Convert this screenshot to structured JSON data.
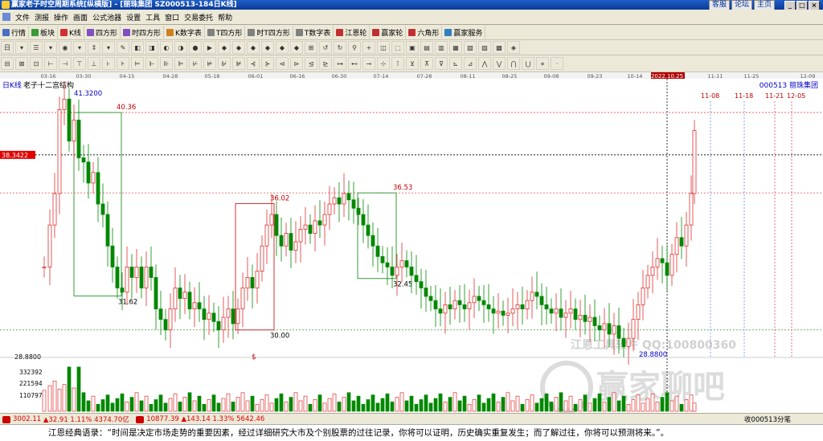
{
  "window": {
    "title": "赢家老子时空周期系统[纵横版] - [丽珠集团  SZ000513-184日K线]",
    "links": [
      "客服",
      "论坛",
      "主页"
    ],
    "controls": [
      "_",
      "□",
      "×"
    ]
  },
  "menu": [
    "文件",
    "测报",
    "操作",
    "画面",
    "公式池器",
    "设置",
    "工具",
    "窗口",
    "交易委托",
    "帮助"
  ],
  "toolbar1": [
    {
      "label": "行情",
      "color": "#4a6fc0"
    },
    {
      "label": "板块",
      "color": "#3a9a3a"
    },
    {
      "label": "K线",
      "color": "#d03030"
    },
    {
      "label": "四方形",
      "color": "#8050c0"
    },
    {
      "label": "时四方形",
      "color": "#8050c0"
    },
    {
      "label": "K数字表",
      "color": "#d08020"
    },
    {
      "label": "T四方形",
      "color": "#808080"
    },
    {
      "label": "时T四方形",
      "color": "#808080"
    },
    {
      "label": "T数字表",
      "color": "#808080"
    },
    {
      "label": "江恩轮",
      "color": "#c03030"
    },
    {
      "label": "赢家轮",
      "color": "#c03030"
    },
    {
      "label": "六角形",
      "color": "#c03030"
    },
    {
      "label": "赢家服务",
      "color": "#3080c0"
    }
  ],
  "toolbar2": [
    "日",
    "▾",
    "☰",
    "▾",
    "◉",
    "▾",
    "⇕",
    "▾",
    "✎",
    "◧",
    "◨",
    "◐",
    "◑",
    "●",
    "▶",
    "◆",
    "◆",
    "◆",
    "◆",
    "◆",
    "◆",
    "⊞",
    "↺",
    "↻",
    "⚲",
    "+",
    "◫",
    "⬚",
    "▣",
    "▤",
    "▥",
    "▦",
    "▧",
    "▨",
    "▩",
    "◈"
  ],
  "toolbar3": [
    "⊟",
    "⊠",
    "⊡",
    "⊢",
    "⊣",
    "⊤",
    "⊥",
    "⊦",
    "⊧",
    "⊨",
    "⊩",
    "⊪",
    "⊫",
    "⊬",
    "⊭",
    "⊮",
    "⊯",
    "⊰",
    "⊱",
    "⊲",
    "⊳",
    "⊴",
    "⊵",
    "⊶",
    "⊷",
    "⊸",
    "⊹",
    "⊺",
    "⊻",
    "⊼",
    "⊽",
    "⊾",
    "⊿",
    "⋀",
    "⋁",
    "⋂",
    "⋃",
    "⋄",
    "⋅"
  ],
  "chart": {
    "period_label": "日K线",
    "stock_label": "000513  丽珠集团",
    "structure_label": "老子十二宫结构",
    "date_ticks": [
      "03-16",
      "03-30",
      "04-15",
      "04-28",
      "05-18",
      "06-01",
      "06-16",
      "06-30",
      "07-14",
      "07-28",
      "08-11",
      "08-25",
      "09-08",
      "09-23",
      "10-14",
      "2022.10.25",
      "11-11",
      "11-25",
      "12-09"
    ],
    "cursor_price": "38.3422",
    "low_label": "28.8800",
    "annotations": [
      "41.3200",
      "40.36",
      "31.62",
      "36.02",
      "30.00",
      "36.53",
      "32.45",
      "28.8800"
    ],
    "future_dates": [
      "11-08",
      "11-18",
      "11-21",
      "12-05"
    ],
    "vol_ticks": [
      "332392",
      "221594",
      "110797"
    ],
    "watermark_1": "江恩工具软件 QQ:100800360",
    "watermark_2": "赢家聊吧"
  },
  "chart_data": {
    "type": "candlestick",
    "title": "丽珠集团 000513 日K线",
    "ylim": [
      28.88,
      41.32
    ]
  },
  "status": {
    "sh": "3002.11",
    "sh_chg": "▲32.91 1.11% 4374.70亿",
    "sz": "10877.39",
    "sz_chg": "▲143.14 1.33% 5642.46",
    "right": "收000513分笔"
  },
  "quote": "江恩经典语录：“时间是决定市场走势的重要因素，经过详细研究大市及个别股票的过往记录，你将可以证明，历史确实重复发生；而了解过往，你将可以预测将来。”。"
}
